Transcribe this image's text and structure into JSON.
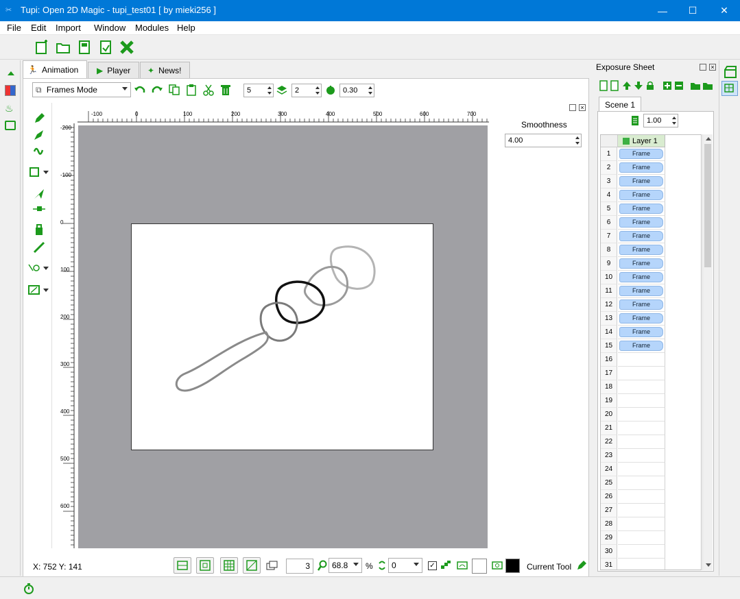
{
  "window": {
    "title": "Tupi: Open 2D Magic - tupi_test01 [ by mieki256 ]",
    "minimize": "—",
    "maximize": "☐",
    "close": "✕"
  },
  "menu": [
    "File",
    "Edit",
    "Import",
    "Window",
    "Modules",
    "Help"
  ],
  "tabs": [
    {
      "label": "Animation",
      "active": true
    },
    {
      "label": "Player",
      "active": false
    },
    {
      "label": "News!",
      "active": false
    }
  ],
  "anim_toolbar": {
    "mode": "Frames Mode",
    "onion_prev": "5",
    "onion_next": "2",
    "opacity": "0.30"
  },
  "rulers": {
    "top": [
      "-100",
      "0",
      "100",
      "200",
      "300",
      "400",
      "500",
      "600",
      "700"
    ],
    "left": [
      "-200",
      "-100",
      "0",
      "100",
      "200",
      "300",
      "400",
      "500",
      "600"
    ]
  },
  "smoothness": {
    "label": "Smoothness",
    "value": "4.00"
  },
  "status": {
    "coords": "X: 752 Y: 141",
    "frame_field": "3",
    "zoom": "68.8",
    "percent": "%",
    "rotation": "0",
    "current_tool_label": "Current Tool"
  },
  "exposure": {
    "title": "Exposure Sheet",
    "scene_tab": "Scene 1",
    "fps": "1.00",
    "layer": "Layer 1",
    "frame_label": "Frame",
    "filled_frames": 15,
    "rows": [
      "1",
      "2",
      "3",
      "4",
      "5",
      "6",
      "7",
      "8",
      "9",
      "10",
      "11",
      "12",
      "13",
      "14",
      "15",
      "16",
      "17",
      "18",
      "19",
      "20",
      "21",
      "22",
      "23",
      "24",
      "25",
      "26",
      "27",
      "28",
      "29",
      "30",
      "31"
    ]
  },
  "colors": {
    "accent": "#0078d7",
    "tool_green": "#1c9a1c",
    "frame_blue": "#b5d5fb",
    "stage_gray": "#a0a0a4"
  }
}
